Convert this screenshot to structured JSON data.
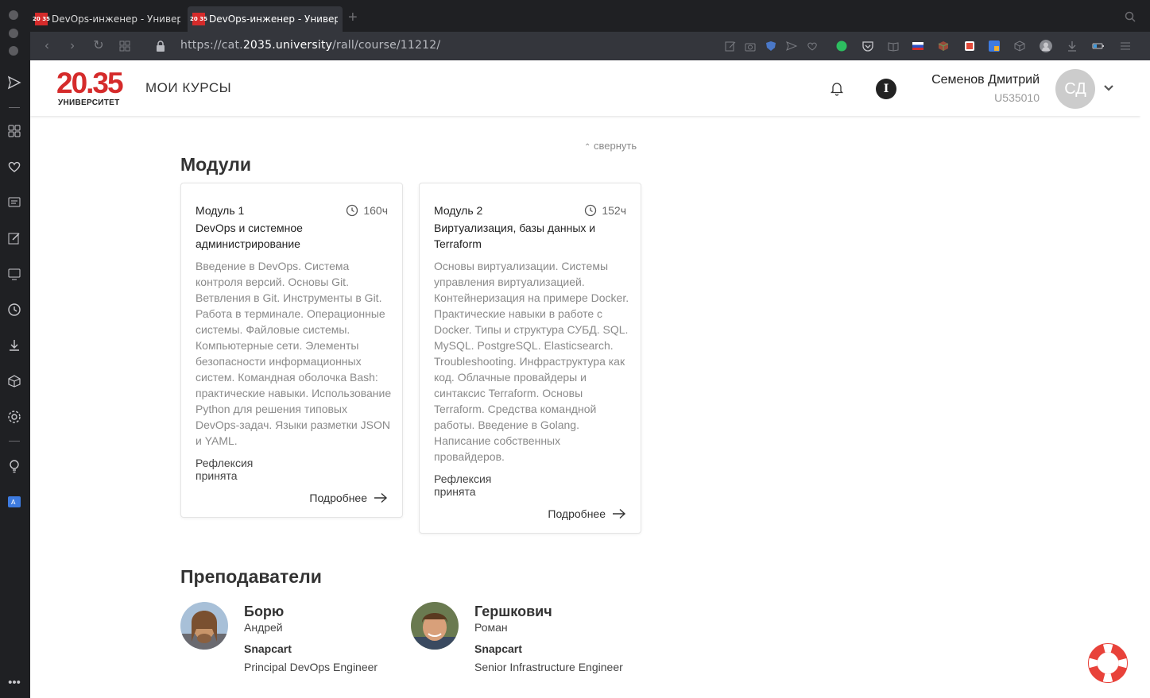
{
  "browser": {
    "tabs": [
      {
        "favicon": "20 35",
        "title": "DevOps-инженер - Университ"
      },
      {
        "favicon": "20 35",
        "title": "DevOps-инженер - Университ"
      }
    ],
    "url_prefix": "https://cat.",
    "url_domain": "2035.university",
    "url_path": "/rall/course/11212/"
  },
  "header": {
    "logo_number": "20.35",
    "logo_subtitle": "УНИВЕРСИТЕТ",
    "nav_label": "МОИ КУРСЫ",
    "info_badge": "I",
    "user_name": "Семенов Дмитрий",
    "user_id": "U535010",
    "avatar_initials": "СД"
  },
  "modules": {
    "heading": "Модули",
    "collapse_label": "свернуть",
    "items": [
      {
        "number": "Модуль 1",
        "hours": "160ч",
        "title": "DevOps и системное администрирование",
        "description": "Введение в DevOps. Система контроля версий. Основы Git. Ветвления в Git. Инструменты в Git. Работа в терминале. Операционные системы. Файловые системы. Компьютерные сети. Элементы безопасности информационных систем. Командная оболочка Bash: практические навыки. Использование Python для решения типовых DevOps-задач. Языки разметки JSON и YAML.",
        "status": "Рефлексия принята",
        "more": "Подробнее"
      },
      {
        "number": "Модуль 2",
        "hours": "152ч",
        "title": "Виртуализация, базы данных и Terraform",
        "description": "Основы виртуализации. Системы управления виртуализацией. Контейнеризация на примере Docker. Практические навыки в работе с Docker. Типы и структура СУБД. SQL. MySQL. PostgreSQL. Elasticsearch. Troubleshooting. Инфраструктура как код. Облачные провайдеры и синтаксис Terraform. Основы Terraform. Средства командной работы. Введение в Golang. Написание собственных провайдеров.",
        "status": "Рефлексия принята",
        "more": "Подробнее"
      }
    ]
  },
  "teachers": {
    "heading": "Преподаватели",
    "items": [
      {
        "surname": "Борю",
        "first_name": "Андрей",
        "company": "Snapcart",
        "role": "Principal DevOps Engineer"
      },
      {
        "surname": "Гершкович",
        "first_name": "Роман",
        "company": "Snapcart",
        "role": "Senior Infrastructure Engineer"
      }
    ]
  },
  "colors": {
    "brand_red": "#d52b2b",
    "browser_chrome": "#1f2023",
    "address_bar": "#34363c",
    "lifebuoy": "#e8423a"
  }
}
